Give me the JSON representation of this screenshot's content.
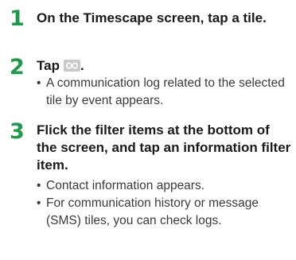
{
  "steps": [
    {
      "number": "1",
      "title": "On the Timescape screen, tap a tile.",
      "bullets": []
    },
    {
      "number": "2",
      "title": "Tap",
      "title_suffix": ".",
      "icon": "infinity-button-icon",
      "bullets": [
        "A communication log related to the selected tile by event appears."
      ]
    },
    {
      "number": "3",
      "title": "Flick the filter items at the bottom of the screen, and tap an information filter item.",
      "bullets": [
        "Contact information appears.",
        "For communication history or message (SMS) tiles, you can check logs."
      ]
    }
  ],
  "bullet_glyph": "•",
  "colors": {
    "step_number": "#1f9a4a",
    "title_text": "#1a1a1a",
    "body_text": "#3a3a3a",
    "icon_background": "#c9c9c9",
    "icon_glyph": "#ffffff"
  }
}
